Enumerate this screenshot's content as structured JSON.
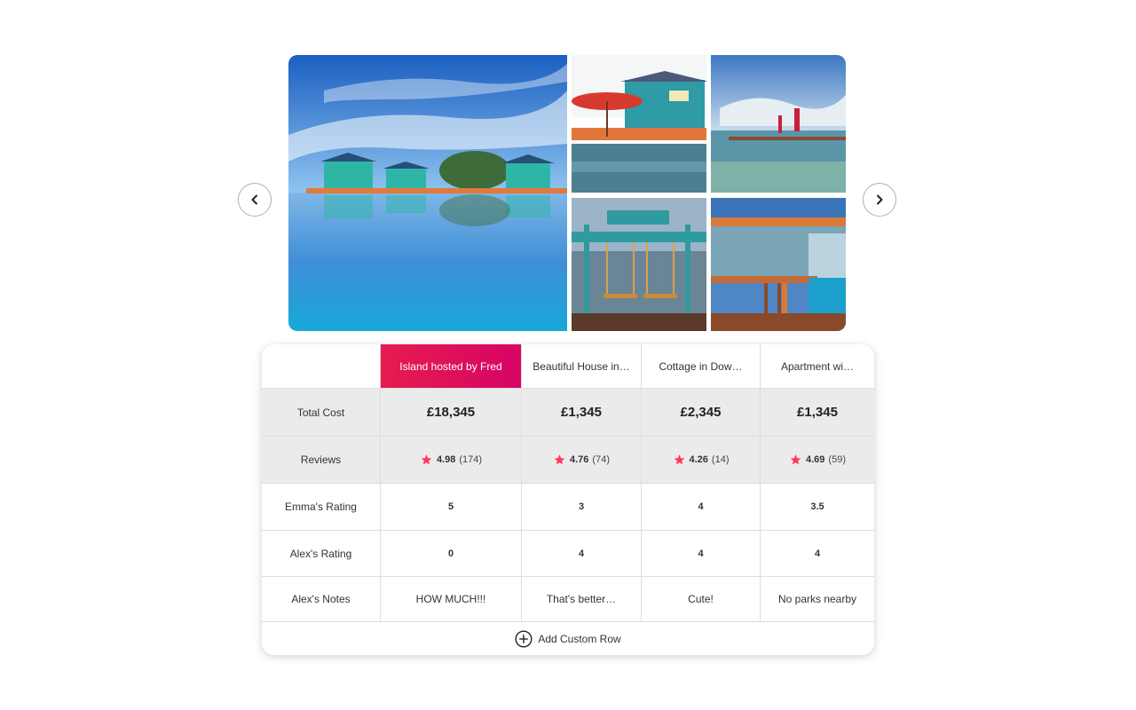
{
  "gallery": {
    "photos": [
      "island-overview-photo",
      "deck-house-photo",
      "pier-photo",
      "swing-dock-photo",
      "bar-photo"
    ],
    "prev_label": "previous",
    "next_label": "next"
  },
  "table": {
    "columns": [
      {
        "title": "Island hosted by Fred",
        "cost": "£18,345",
        "score": "4.98",
        "count": "(174)",
        "emma": "5",
        "alex": "0",
        "notes": "HOW MUCH!!!"
      },
      {
        "title": "Beautiful House in…",
        "cost": "£1,345",
        "score": "4.76",
        "count": "(74)",
        "emma": "3",
        "alex": "4",
        "notes": "That's better…"
      },
      {
        "title": "Cottage in Dow…",
        "cost": "£2,345",
        "score": "4.26",
        "count": "(14)",
        "emma": "4",
        "alex": "4",
        "notes": "Cute!"
      },
      {
        "title": "Apartment wi…",
        "cost": "£1,345",
        "score": "4.69",
        "count": "(59)",
        "emma": "3.5",
        "alex": "4",
        "notes": "No parks nearby"
      }
    ],
    "row_labels": {
      "cost": "Total Cost",
      "reviews": "Reviews",
      "emma": "Emma's Rating",
      "alex": "Alex's Rating",
      "notes": "Alex's Notes"
    },
    "add_row_label": "Add Custom Row"
  },
  "colors": {
    "accent_start": "#e51c4f",
    "accent_end": "#d70466",
    "star": "#ff385c"
  }
}
